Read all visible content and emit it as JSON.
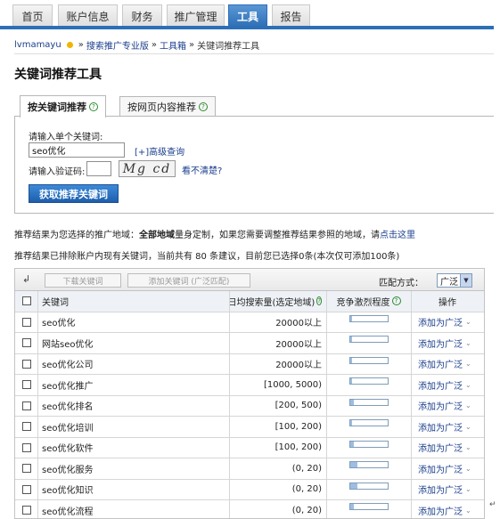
{
  "nav": {
    "tabs": [
      {
        "label": "首页"
      },
      {
        "label": "账户信息"
      },
      {
        "label": "财务"
      },
      {
        "label": "推广管理"
      },
      {
        "label": "工具"
      },
      {
        "label": "报告"
      }
    ],
    "active_tab": "工具"
  },
  "breadcrumb": {
    "user": "lvmamayu",
    "sep": "»",
    "items": [
      "搜索推广专业版",
      "工具箱",
      "关键词推荐工具"
    ]
  },
  "page_title": "关键词推荐工具",
  "panel_tabs": [
    {
      "label": "按关键词推荐"
    },
    {
      "label": "按网页内容推荐"
    }
  ],
  "form": {
    "keyword_label": "请输入单个关键词:",
    "keyword_value": "seo优化",
    "advanced_link": "[+]高级查询",
    "captcha_label": "请输入验证码:",
    "captcha_text": "Mg cd",
    "unclear_link": "看不清楚?",
    "submit_label": "获取推荐关键词"
  },
  "notes": {
    "line1_prefix": "推荐结果为您选择的推广地域：",
    "line1_bold": "全部地域",
    "line1_mid": "量身定制，如果您需要调整推荐结果参照的地域，请",
    "line1_link": "点击这里",
    "line2": "推荐结果已排除账户内现有关键词，当前共有 80 条建议，目前您已选择0条(本次仅可添加100条)"
  },
  "toolbar": {
    "sort_icon": "↲",
    "download_label": "下载关键词",
    "add_label": "添加关键词 (广泛匹配)",
    "match_label": "匹配方式：",
    "match_value": "广泛"
  },
  "table": {
    "headers": {
      "keyword": "关键词",
      "volume": "日均搜索量(选定地域)",
      "competition": "竞争激烈程度",
      "action": "操作"
    },
    "action_label": "添加为广泛",
    "rows": [
      {
        "keyword": "seo优化",
        "volume": "20000以上",
        "competition": 0.05
      },
      {
        "keyword": "网站seo优化",
        "volume": "20000以上",
        "competition": 0.05
      },
      {
        "keyword": "seo优化公司",
        "volume": "20000以上",
        "competition": 0.05
      },
      {
        "keyword": "seo优化推广",
        "volume": "[1000, 5000)",
        "competition": 0.05
      },
      {
        "keyword": "seo优化排名",
        "volume": "[200, 500)",
        "competition": 0.1
      },
      {
        "keyword": "seo优化培训",
        "volume": "[100, 200)",
        "competition": 0.05
      },
      {
        "keyword": "seo优化软件",
        "volume": "[100, 200)",
        "competition": 0.1
      },
      {
        "keyword": "seo优化服务",
        "volume": "(0, 20)",
        "competition": 0.2
      },
      {
        "keyword": "seo优化知识",
        "volume": "(0, 20)",
        "competition": 0.2
      },
      {
        "keyword": "seo优化流程",
        "volume": "(0, 20)",
        "competition": 0.1
      }
    ]
  },
  "end_mark": "↵"
}
